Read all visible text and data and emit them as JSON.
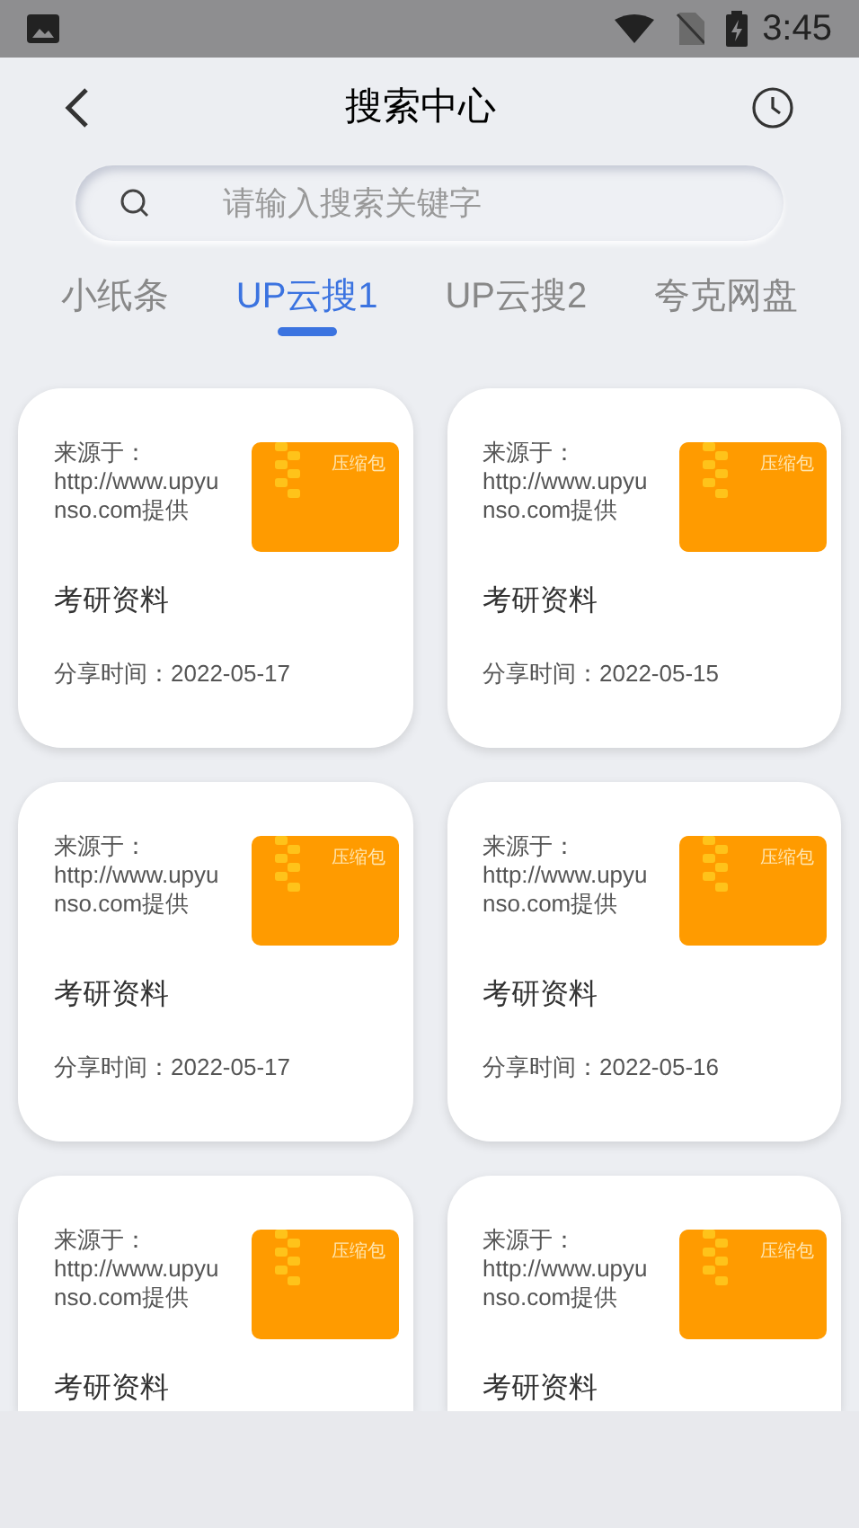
{
  "status_bar": {
    "time": "3:45"
  },
  "header": {
    "title": "搜索中心"
  },
  "search": {
    "placeholder": "请输入搜索关键字"
  },
  "tabs": [
    {
      "label": "小纸条",
      "selected": false
    },
    {
      "label": "UP云搜1",
      "selected": true
    },
    {
      "label": "UP云搜2",
      "selected": false
    },
    {
      "label": "夸克网盘",
      "selected": false
    }
  ],
  "results": [
    {
      "source": "来源于：http://www.upyunso.com提供",
      "badge": "压缩包",
      "title": "考研资料",
      "shared": "分享时间：2022-05-17"
    },
    {
      "source": "来源于：http://www.upyunso.com提供",
      "badge": "压缩包",
      "title": "考研资料",
      "shared": "分享时间：2022-05-15"
    },
    {
      "source": "来源于：http://www.upyunso.com提供",
      "badge": "压缩包",
      "title": "考研资料",
      "shared": "分享时间：2022-05-17"
    },
    {
      "source": "来源于：http://www.upyunso.com提供",
      "badge": "压缩包",
      "title": "考研资料",
      "shared": "分享时间：2022-05-16"
    },
    {
      "source": "来源于：http://www.upyunso.com提供",
      "badge": "压缩包",
      "title": "考研资料"
    },
    {
      "source": "来源于：http://www.upyunso.com提供",
      "badge": "压缩包",
      "title": "考研资料"
    }
  ]
}
